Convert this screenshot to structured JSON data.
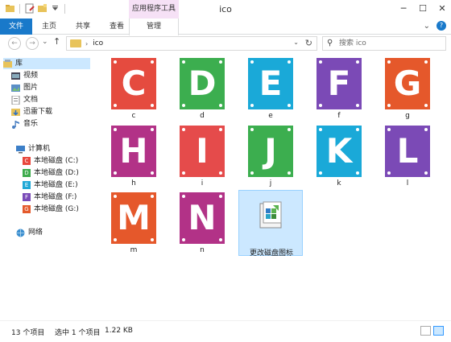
{
  "window": {
    "title": "ico",
    "context_tab_group": "应用程序工具",
    "minimize": "─",
    "maximize": "☐",
    "close": "✕"
  },
  "ribbon": {
    "tabs": [
      "文件",
      "主页",
      "共享",
      "查看"
    ],
    "manage_tab": "管理",
    "expand_glyph": "⌄",
    "help_glyph": "?"
  },
  "navigation": {
    "back_glyph": "←",
    "forward_glyph": "→",
    "recent_glyph": "⌄",
    "up_glyph": "↑",
    "path_separator": "›",
    "path": "ico",
    "dropdown_glyph": "⌄",
    "refresh_glyph": "↻",
    "search_placeholder": "搜索 ico",
    "search_icon_glyph": "⚲"
  },
  "nav_pane": {
    "library": {
      "label": "库",
      "items": [
        "视频",
        "图片",
        "文档",
        "迅雷下载",
        "音乐"
      ]
    },
    "computer": {
      "label": "计算机",
      "drives": [
        {
          "letter": "C",
          "label": "本地磁盘 (C:)",
          "color": "#e8473c"
        },
        {
          "letter": "D",
          "label": "本地磁盘 (D:)",
          "color": "#3dab4c"
        },
        {
          "letter": "E",
          "label": "本地磁盘 (E:)",
          "color": "#1fa8d6"
        },
        {
          "letter": "F",
          "label": "本地磁盘 (F:)",
          "color": "#7a4bb8"
        },
        {
          "letter": "G",
          "label": "本地磁盘 (G:)",
          "color": "#e45a2c"
        }
      ]
    },
    "network": {
      "label": "网络"
    }
  },
  "files": [
    {
      "letter": "C",
      "name": "c",
      "color": "#e54b3f"
    },
    {
      "letter": "D",
      "name": "d",
      "color": "#3cae4f"
    },
    {
      "letter": "E",
      "name": "e",
      "color": "#1aa9d8"
    },
    {
      "letter": "F",
      "name": "f",
      "color": "#7b4ab6"
    },
    {
      "letter": "G",
      "name": "g",
      "color": "#e5582b"
    },
    {
      "letter": "H",
      "name": "h",
      "color": "#b23287"
    },
    {
      "letter": "I",
      "name": "i",
      "color": "#e54b4b"
    },
    {
      "letter": "J",
      "name": "j",
      "color": "#3cae4f"
    },
    {
      "letter": "K",
      "name": "k",
      "color": "#1aa9d8"
    },
    {
      "letter": "L",
      "name": "l",
      "color": "#7b4ab6"
    },
    {
      "letter": "M",
      "name": "m",
      "color": "#e5582b"
    },
    {
      "letter": "N",
      "name": "n",
      "color": "#b23287"
    }
  ],
  "selected_file": {
    "name": "更改磁盘图标",
    "icon": "registry-file-icon"
  },
  "status": {
    "item_count": "13 个项目",
    "selection": "选中 1 个项目",
    "size": "1.22 KB"
  }
}
